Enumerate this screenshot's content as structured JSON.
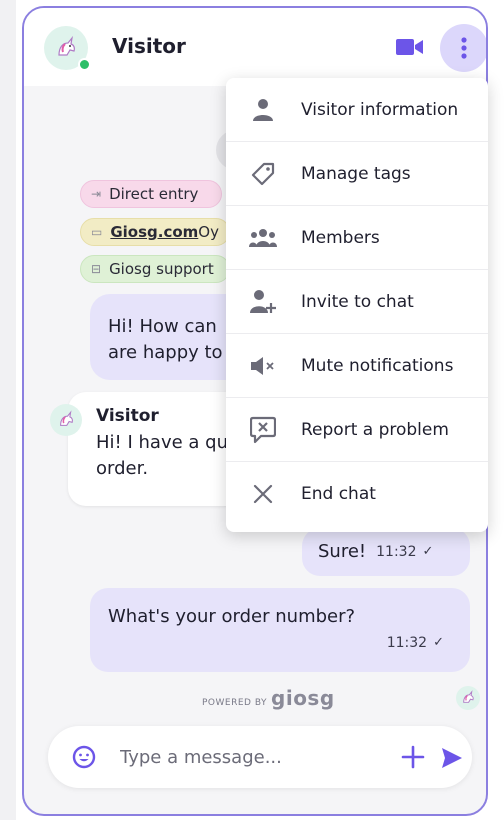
{
  "header": {
    "title": "Visitor",
    "status": "online",
    "accent_color": "#6c55e8",
    "icons": [
      "unicorn-avatar-icon",
      "video-camera-icon",
      "more-vertical-icon"
    ]
  },
  "menu": {
    "items": [
      {
        "label": "Visitor information",
        "icon": "person-icon"
      },
      {
        "label": "Manage tags",
        "icon": "tag-icon"
      },
      {
        "label": "Members",
        "icon": "group-icon"
      },
      {
        "label": "Invite to chat",
        "icon": "add-person-icon"
      },
      {
        "label": "Mute notifications",
        "icon": "speaker-mute-icon"
      },
      {
        "label": "Report a problem",
        "icon": "report-icon"
      },
      {
        "label": "End chat",
        "icon": "close-icon"
      }
    ]
  },
  "tags": {
    "entry": "Direct entry",
    "company": "Giosg.com",
    "company_suffix": " Oy",
    "team": "Giosg support"
  },
  "messages": {
    "agent_greeting_line1": "Hi! How can",
    "agent_greeting_line2": "are happy to",
    "visitor_sender": "Visitor",
    "visitor_line1": "Hi! I have a qu",
    "visitor_line2": "order.",
    "sure_text": "Sure!",
    "sure_time": "11:32",
    "order_text": "What's your order number?",
    "order_time": "11:32"
  },
  "footer": {
    "powered_by": "POWERED BY",
    "brand": "giosg"
  },
  "composer": {
    "placeholder": "Type a message..."
  }
}
